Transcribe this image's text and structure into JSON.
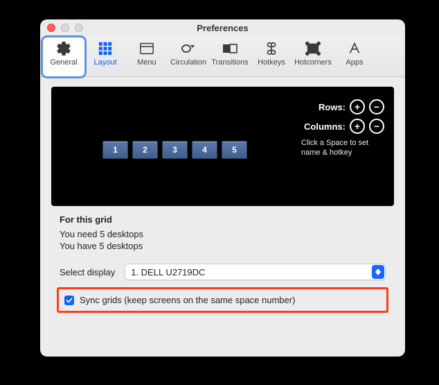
{
  "window": {
    "title": "Preferences"
  },
  "toolbar": {
    "items": [
      {
        "id": "general",
        "label": "General"
      },
      {
        "id": "layout",
        "label": "Layout"
      },
      {
        "id": "menu",
        "label": "Menu"
      },
      {
        "id": "circulation",
        "label": "Circulation"
      },
      {
        "id": "transitions",
        "label": "Transitions"
      },
      {
        "id": "hotkeys",
        "label": "Hotkeys"
      },
      {
        "id": "hotcorners",
        "label": "Hotcorners"
      },
      {
        "id": "apps",
        "label": "Apps"
      }
    ]
  },
  "grid": {
    "spaces": [
      "1",
      "2",
      "3",
      "4",
      "5"
    ],
    "rows_label": "Rows:",
    "cols_label": "Columns:",
    "hint": "Click a Space to set name & hotkey"
  },
  "info": {
    "heading": "For this grid",
    "need": "You need 5 desktops",
    "have": "You have 5 desktops"
  },
  "display": {
    "label": "Select display",
    "value": "1. DELL U2719DC"
  },
  "sync": {
    "checked": true,
    "label": "Sync grids (keep screens on the same space number)"
  }
}
